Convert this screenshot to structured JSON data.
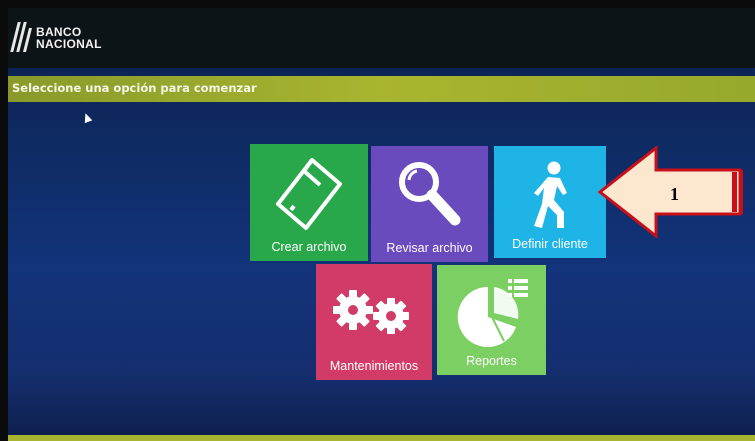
{
  "app": {
    "logo_line1": "BANCO",
    "logo_line2": "NACIONAL"
  },
  "banner": {
    "prompt": "Seleccione una opción para comenzar"
  },
  "tiles": [
    {
      "label": "Crear archivo",
      "color": "#28a84a",
      "icon": "file-icon"
    },
    {
      "label": "Revisar archivo",
      "color": "#6a4bbd",
      "icon": "magnifier-icon"
    },
    {
      "label": "Definir cliente",
      "color": "#1fb4e6",
      "icon": "walking-person-icon"
    },
    {
      "label": "Mantenimientos",
      "color": "#d23b67",
      "icon": "gears-icon"
    },
    {
      "label": "Reportes",
      "color": "#7ccf63",
      "icon": "pie-chart-icon"
    }
  ],
  "annotation": {
    "number": "1",
    "arrow_color": "#c8101a",
    "arrow_fill": "#fde7cf"
  }
}
